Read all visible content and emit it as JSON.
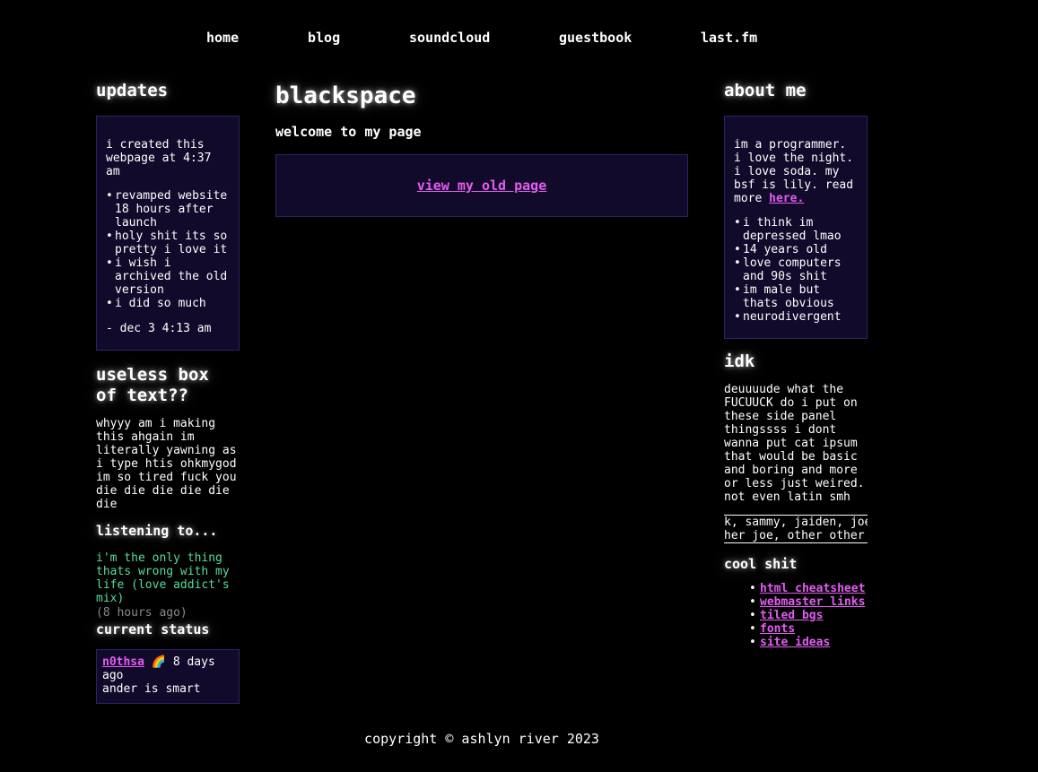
{
  "nav": {
    "items": [
      {
        "label": "home"
      },
      {
        "label": "blog"
      },
      {
        "label": "soundcloud"
      },
      {
        "label": "guestbook"
      },
      {
        "label": "last.fm"
      }
    ]
  },
  "left": {
    "updates_title": "updates",
    "updates_intro": "i created this webpage at 4:37 am",
    "updates_items": [
      "revamped website 18 hours after launch",
      "holy shit its so pretty i love it",
      "i wish i archived the old version",
      "i did so much"
    ],
    "updates_signoff": "- dec 3 4:13 am",
    "useless_title": "useless box of text??",
    "useless_text": "whyyy am i making this ahgain im literally yawning as i type htis ohkmygod im so tired fuck you die die die die die die",
    "listening_title": "listening to...",
    "listening_song": "i'm the only thing thats wrong with my life (love addict's mix)",
    "listening_time": "(8 hours ago)",
    "status_title": "current status",
    "status_user": "n0thsa",
    "status_emoji": "🌈",
    "status_time": "8 days ago",
    "status_text": "ander is smart"
  },
  "main": {
    "title": "blackspace",
    "subtitle": "welcome to my page",
    "old_page_link": "view my old page"
  },
  "right": {
    "about_title": "about me",
    "about_intro": "im a programmer. i love the night. i love soda. my bsf is lily. read more",
    "about_link": "here.",
    "about_items": [
      "i think im depressed lmao",
      "14 years old",
      "love computers and 90s shit",
      "im male but thats obvious",
      "neurodivergent"
    ],
    "idk_title": "idk",
    "idk_text": "deuuuude what the FUCUUCK do i put on these side panel thingssss i dont wanna put cat ipsum that would be basic and boring and more or less just weired. not even latin smh",
    "names_line1": "k, sammy, jaiden, joe",
    "names_line2": "her joe, other other j",
    "cool_title": "cool shit",
    "cool_links": [
      "html cheatsheet",
      "webmaster links",
      "tiled bgs",
      "fonts",
      "site ideas"
    ]
  },
  "footer": {
    "copyright": "copyright © ashlyn river 2023"
  },
  "colors": {
    "background": "#000000",
    "box": "#120a2a",
    "link": "#e35cf2",
    "song": "#55dd99"
  }
}
